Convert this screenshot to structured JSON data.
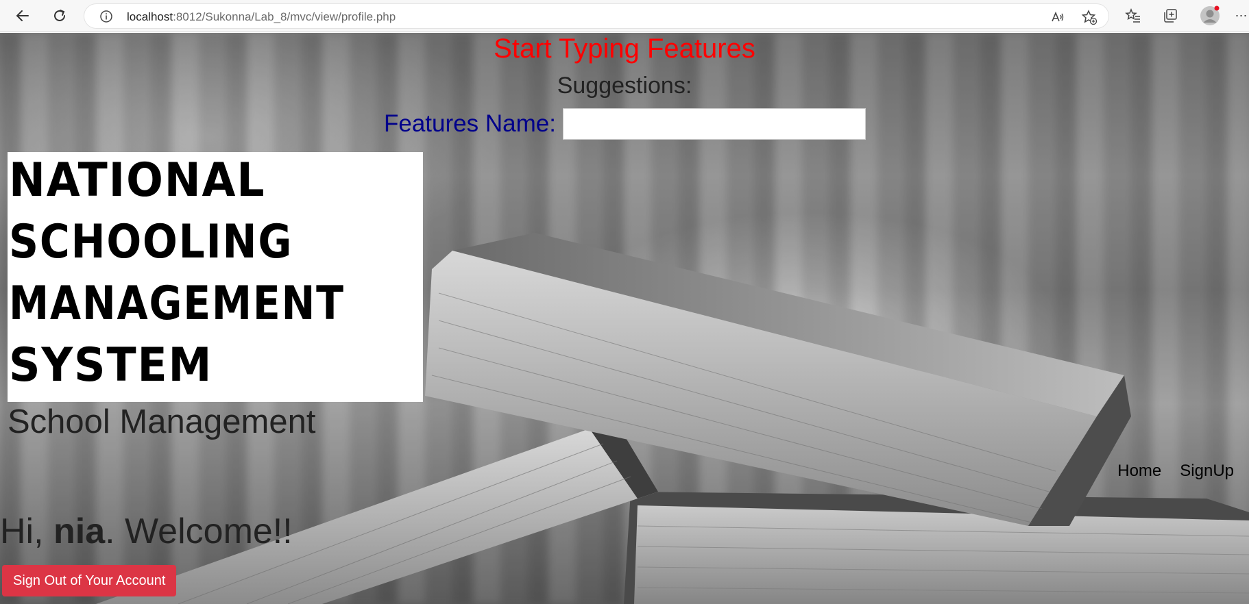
{
  "browser": {
    "url_host": "localhost",
    "url_path": ":8012/Sukonna/Lab_8/mvc/view/profile.php",
    "icons": [
      "back-arrow-icon",
      "reload-icon",
      "info-icon",
      "read-aloud-icon",
      "add-favorite-icon",
      "favorites-icon",
      "collections-icon",
      "profile-avatar-icon",
      "more-icon"
    ],
    "notification_dot_color": "#e81123"
  },
  "search": {
    "title": "Start Typing Features",
    "suggestions_label": "Suggestions:",
    "feature_label": "Features Name:",
    "feature_value": ""
  },
  "logo": {
    "lines": [
      "NATIONAL",
      "SCHOOLING",
      "MANAGEMENT",
      "SYSTEM"
    ]
  },
  "header": {
    "site_title": "School Management"
  },
  "nav": {
    "home": "Home",
    "signup": "SignUp"
  },
  "welcome": {
    "greeting": "Hi, ",
    "username": "nia",
    "suffix": ". Welcome!!"
  },
  "actions": {
    "signout_label": "Sign Out of Your Account",
    "signout_color": "#dc3545"
  },
  "colors": {
    "title_red": "#ff0000",
    "label_navy": "#00008b"
  }
}
